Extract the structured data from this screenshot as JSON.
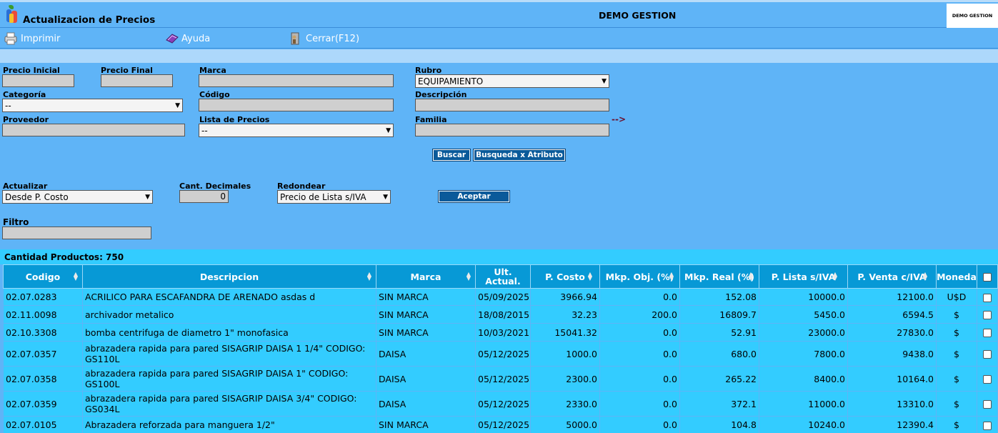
{
  "header": {
    "title": "Actualizacion de Precios",
    "company": "DEMO GESTION",
    "badge": "DEMO GESTION"
  },
  "menu": {
    "print": "Imprimir",
    "help": "Ayuda",
    "close": "Cerrar(F12)"
  },
  "search": {
    "precio_inicial": {
      "label": "Precio Inicial",
      "value": ""
    },
    "precio_final": {
      "label": "Precio Final",
      "value": ""
    },
    "marca": {
      "label": "Marca",
      "value": ""
    },
    "rubro": {
      "label": "Rubro",
      "value": "EQUIPAMIENTO"
    },
    "categoria": {
      "label": "Categoría",
      "value": "--"
    },
    "codigo": {
      "label": "Código",
      "value": ""
    },
    "descripcion": {
      "label": "Descripción",
      "value": ""
    },
    "proveedor": {
      "label": "Proveedor",
      "value": ""
    },
    "lista_precios": {
      "label": "Lista de Precios",
      "value": "--"
    },
    "familia": {
      "label": "Familia",
      "value": ""
    },
    "arrow": "-->",
    "buscar": "Buscar",
    "buscar_atributo": "Busqueda x Atributo"
  },
  "update": {
    "actualizar": {
      "label": "Actualizar",
      "value": "Desde P. Costo"
    },
    "decimales": {
      "label": "Cant. Decimales",
      "value": "0"
    },
    "redondear": {
      "label": "Redondear",
      "value": "Precio de Lista s/IVA"
    },
    "aceptar": "Aceptar",
    "filtro": {
      "label": "Filtro",
      "value": ""
    }
  },
  "results": {
    "count_label": "Cantidad Productos: 750",
    "columns": [
      "Codigo",
      "Descripcion",
      "Marca",
      "Ult. Actual.",
      "P. Costo",
      "Mkp. Obj. (%)",
      "Mkp. Real (%)",
      "P. Lista s/IVA",
      "P. Venta c/IVA",
      "Moneda"
    ],
    "rows": [
      [
        "02.07.0283",
        "ACRILICO PARA ESCAFANDRA DE ARENADO asdas d",
        "SIN MARCA",
        "05/09/2025",
        "3966.94",
        "0.0",
        "152.08",
        "10000.0",
        "12100.0",
        "U$D"
      ],
      [
        "02.11.0098",
        "archivador metalico",
        "SIN MARCA",
        "18/08/2015",
        "32.23",
        "200.0",
        "16809.7",
        "5450.0",
        "6594.5",
        "$"
      ],
      [
        "02.10.3308",
        "bomba centrifuga de diametro 1\" monofasica",
        "SIN MARCA",
        "10/03/2021",
        "15041.32",
        "0.0",
        "52.91",
        "23000.0",
        "27830.0",
        "$"
      ],
      [
        "02.07.0357",
        "abrazadera rapida para pared SISAGRIP DAISA 1 1/4\" CODIGO: GS110L",
        "DAISA",
        "05/12/2025",
        "1000.0",
        "0.0",
        "680.0",
        "7800.0",
        "9438.0",
        "$"
      ],
      [
        "02.07.0358",
        "abrazadera rapida para pared SISAGRIP DAISA 1\" CODIGO: GS100L",
        "DAISA",
        "05/12/2025",
        "2300.0",
        "0.0",
        "265.22",
        "8400.0",
        "10164.0",
        "$"
      ],
      [
        "02.07.0359",
        "abrazadera rapida para pared SISAGRIP DAISA 3/4\" CODIGO: GS034L",
        "DAISA",
        "05/12/2025",
        "2330.0",
        "0.0",
        "372.1",
        "11000.0",
        "13310.0",
        "$"
      ],
      [
        "02.07.0105",
        "Abrazadera reforzada para manguera 1/2\"",
        "SIN MARCA",
        "05/12/2025",
        "5000.0",
        "0.0",
        "104.8",
        "10240.0",
        "12390.4",
        "$"
      ]
    ]
  }
}
